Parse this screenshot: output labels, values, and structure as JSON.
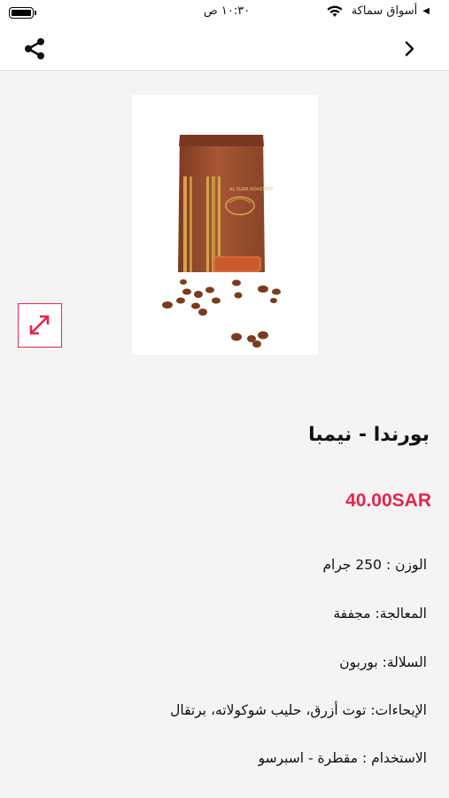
{
  "status_bar": {
    "back_app": "أسواق سماكة",
    "time": "١٠:٣٠ ص"
  },
  "nav": {
    "share_icon": "share-icon",
    "back_icon": "chevron-right-icon"
  },
  "product": {
    "title": "بورندا - نيمبا",
    "price": "40.00SAR",
    "brand_text": "AL SURR ROASTERY",
    "specs": [
      {
        "text": "الوزن : 250 جرام"
      },
      {
        "text": "المعالجة: مجففة"
      },
      {
        "text": "السلالة: بوربون"
      },
      {
        "text": "الإيحاءات:  توت أزرق، حليب شوكولاته، برتقال"
      },
      {
        "text": "الاستخدام : مقطرة - اسبرسو"
      }
    ]
  },
  "colors": {
    "accent": "#e8244d",
    "bag": "#9a4e31"
  }
}
